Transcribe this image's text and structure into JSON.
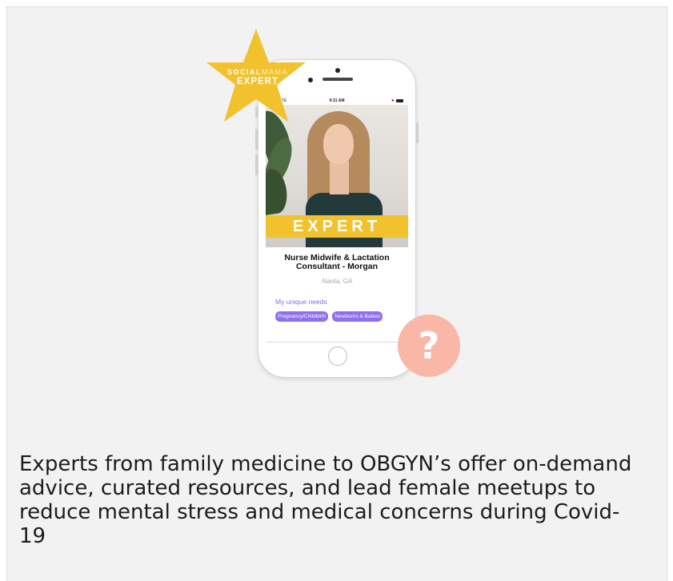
{
  "badge": {
    "brand_bold": "SOCIAL",
    "brand_light": "MAMA",
    "label": "EXPERT"
  },
  "status_bar": {
    "carrier": "zon LTE",
    "time": "9:31 AM"
  },
  "profile": {
    "banner": "EXPERT",
    "title": "Nurse Midwife & Lactation Consultant - Morgan",
    "location": "Alanta, GA",
    "needs_label": "My unique needs",
    "tags": [
      "Pregnancy/Childbirth",
      "Newborns & Babies"
    ]
  },
  "help": {
    "icon": "question-mark-icon",
    "glyph": "?"
  },
  "caption": "Experts from family medicine to OBGYN’s offer on-demand advice, curated resources, and lead female meetups to reduce mental stress and medical concerns during Covid-19",
  "colors": {
    "accent_yellow": "#f2c12e",
    "tag_purple": "#8f6ff0",
    "help_pink": "#f9b7a8",
    "card_bg": "#f2f2f2"
  }
}
